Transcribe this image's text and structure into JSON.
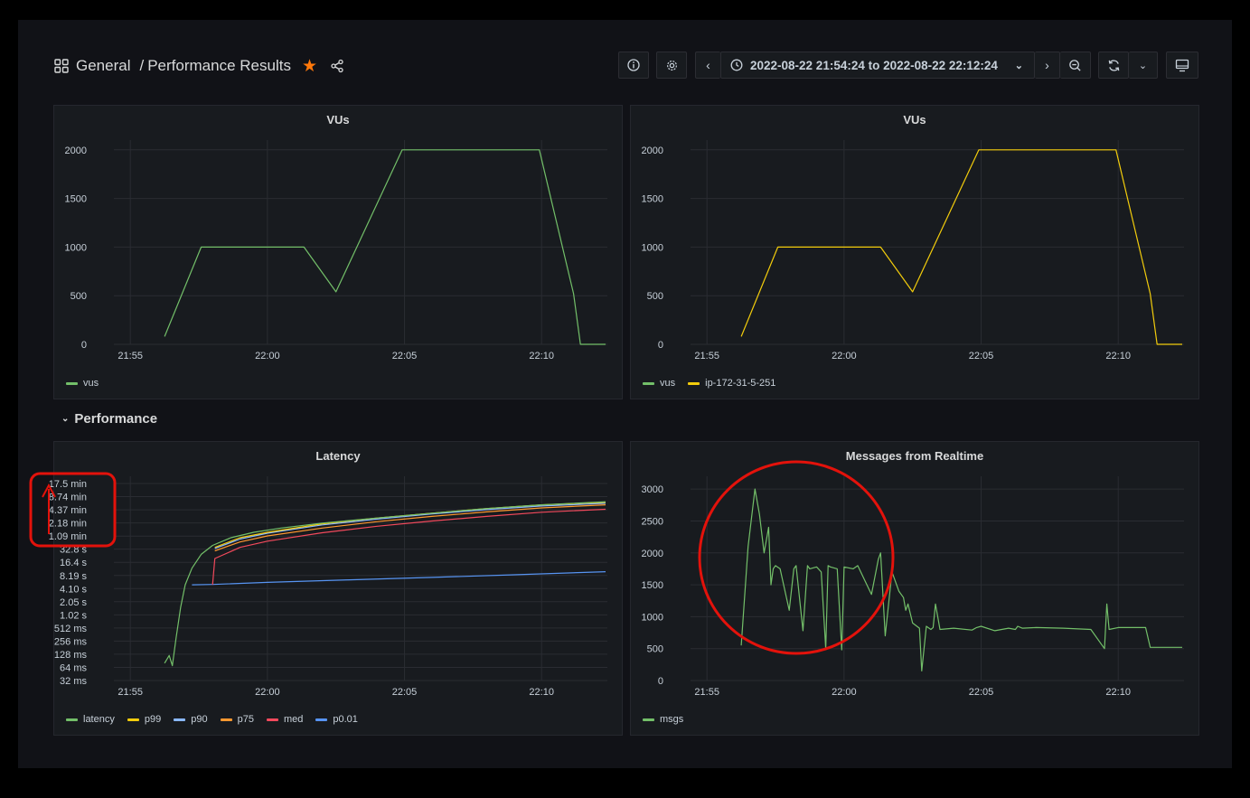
{
  "header": {
    "breadcrumb_root": "General",
    "breadcrumb_sep": "/",
    "breadcrumb_page": "Performance Results"
  },
  "toolbar": {
    "time_range": "2022-08-22 21:54:24 to 2022-08-22 22:12:24"
  },
  "section": {
    "title": "Performance"
  },
  "colors": {
    "green": "#73bf69",
    "yellow": "#f2cc0c",
    "light_blue": "#8ab8ff",
    "orange": "#ff9830",
    "red": "#f2495c",
    "blue": "#5794f2",
    "annotation_red": "#e3120b",
    "star": "#ff780a"
  },
  "panels": {
    "vus1": {
      "title": "VUs",
      "legend": [
        {
          "name": "vus",
          "color": "#73bf69"
        }
      ]
    },
    "vus2": {
      "title": "VUs",
      "legend": [
        {
          "name": "vus",
          "color": "#73bf69"
        },
        {
          "name": "ip-172-31-5-251",
          "color": "#f2cc0c"
        }
      ]
    },
    "latency": {
      "title": "Latency",
      "legend": [
        {
          "name": "latency",
          "color": "#73bf69"
        },
        {
          "name": "p99",
          "color": "#f2cc0c"
        },
        {
          "name": "p90",
          "color": "#8ab8ff"
        },
        {
          "name": "p75",
          "color": "#ff9830"
        },
        {
          "name": "med",
          "color": "#f2495c"
        },
        {
          "name": "p0.01",
          "color": "#5794f2"
        }
      ]
    },
    "messages": {
      "title": "Messages from Realtime",
      "legend": [
        {
          "name": "msgs",
          "color": "#73bf69"
        }
      ]
    }
  },
  "chart_data": [
    {
      "id": "vus1",
      "type": "line",
      "title": "VUs",
      "ylim": [
        0,
        2100
      ],
      "xlim": [
        "21:54:24",
        "22:12:24"
      ],
      "yticks": [
        0,
        500,
        1000,
        1500,
        2000
      ],
      "xticks": [
        "21:55",
        "22:00",
        "22:05",
        "22:10"
      ],
      "series": [
        {
          "name": "vus",
          "color": "#73bf69",
          "x": [
            "21:56:15",
            "21:57:35",
            "22:01:20",
            "22:02:30",
            "22:04:55",
            "22:09:55",
            "22:11:10",
            "22:11:25",
            "22:12:20"
          ],
          "y": [
            80,
            1000,
            1000,
            540,
            2000,
            2000,
            520,
            0,
            0
          ]
        }
      ]
    },
    {
      "id": "vus2",
      "type": "line",
      "title": "VUs",
      "ylim": [
        0,
        2100
      ],
      "xlim": [
        "21:54:24",
        "22:12:24"
      ],
      "yticks": [
        0,
        500,
        1000,
        1500,
        2000
      ],
      "xticks": [
        "21:55",
        "22:00",
        "22:05",
        "22:10"
      ],
      "series": [
        {
          "name": "ip-172-31-5-251",
          "color": "#f2cc0c",
          "x": [
            "21:56:15",
            "21:57:35",
            "22:01:20",
            "22:02:30",
            "22:04:55",
            "22:09:55",
            "22:11:10",
            "22:11:25",
            "22:12:20"
          ],
          "y": [
            80,
            1000,
            1000,
            540,
            2000,
            2000,
            520,
            0,
            0
          ]
        }
      ]
    },
    {
      "id": "latency",
      "type": "line",
      "title": "Latency",
      "scale": "log2",
      "xlim": [
        "21:54:24",
        "22:12:24"
      ],
      "yticks": [
        "32 ms",
        "64 ms",
        "128 ms",
        "256 ms",
        "512 ms",
        "1.02 s",
        "2.05 s",
        "4.10 s",
        "8.19 s",
        "16.4 s",
        "32.8 s",
        "1.09 min",
        "2.18 min",
        "4.37 min",
        "8.74 min",
        "17.5 min"
      ],
      "xticks": [
        "21:55",
        "22:00",
        "22:05",
        "22:10"
      ],
      "series": [
        {
          "name": "latency",
          "color": "#73bf69",
          "x": [
            "21:56:15",
            "21:56:25",
            "21:56:32",
            "21:56:40",
            "21:56:50",
            "21:57:00",
            "21:57:15",
            "21:57:35",
            "21:58:00",
            "21:58:40",
            "21:59:30",
            "22:00:30",
            "22:02:00",
            "22:04:00",
            "22:06:00",
            "22:08:00",
            "22:10:00",
            "22:12:20"
          ],
          "y_ms": [
            80,
            120,
            70,
            300,
            1500,
            5000,
            12000,
            25000,
            40000,
            60000,
            80000,
            100000,
            130000,
            170000,
            220000,
            280000,
            340000,
            400000
          ]
        },
        {
          "name": "p99",
          "color": "#f2cc0c",
          "x": [
            "21:58:05",
            "21:59:00",
            "22:00:00",
            "22:02:00",
            "22:04:00",
            "22:06:00",
            "22:08:00",
            "22:10:00",
            "22:12:20"
          ],
          "y_ms": [
            36000,
            60000,
            80000,
            125000,
            170000,
            220000,
            280000,
            340000,
            390000
          ]
        },
        {
          "name": "p90",
          "color": "#8ab8ff",
          "x": [
            "21:58:05",
            "21:59:00",
            "22:00:00",
            "22:02:00",
            "22:04:00",
            "22:06:00",
            "22:08:00",
            "22:10:00",
            "22:12:20"
          ],
          "y_ms": [
            34000,
            56000,
            76000,
            118000,
            160000,
            210000,
            265000,
            320000,
            370000
          ]
        },
        {
          "name": "p75",
          "color": "#ff9830",
          "x": [
            "21:58:05",
            "21:59:00",
            "22:00:00",
            "22:02:00",
            "22:04:00",
            "22:06:00",
            "22:08:00",
            "22:10:00",
            "22:12:20"
          ],
          "y_ms": [
            30000,
            48000,
            66000,
            100000,
            140000,
            185000,
            235000,
            290000,
            340000
          ]
        },
        {
          "name": "med",
          "color": "#f2495c",
          "x": [
            "21:58:00",
            "21:58:05",
            "21:59:00",
            "22:00:00",
            "22:02:00",
            "22:04:00",
            "22:06:00",
            "22:08:00",
            "22:10:00",
            "22:12:20"
          ],
          "y_ms": [
            5000,
            20000,
            36000,
            50000,
            78000,
            110000,
            145000,
            185000,
            230000,
            270000
          ]
        },
        {
          "name": "p0.01",
          "color": "#5794f2",
          "x": [
            "21:57:15",
            "21:58:00",
            "22:00:00",
            "22:03:00",
            "22:06:00",
            "22:09:00",
            "22:12:20"
          ],
          "y_ms": [
            5000,
            5100,
            5700,
            6500,
            7400,
            8500,
            10000
          ]
        }
      ]
    },
    {
      "id": "messages",
      "type": "line",
      "title": "Messages from Realtime",
      "ylim": [
        0,
        3200
      ],
      "xlim": [
        "21:54:24",
        "22:12:24"
      ],
      "yticks": [
        0,
        500,
        1000,
        1500,
        2000,
        2500,
        3000
      ],
      "xticks": [
        "21:55",
        "22:00",
        "22:05",
        "22:10"
      ],
      "series": [
        {
          "name": "msgs",
          "color": "#73bf69",
          "x": [
            "21:56:15",
            "21:56:30",
            "21:56:45",
            "21:56:55",
            "21:57:05",
            "21:57:15",
            "21:57:20",
            "21:57:25",
            "21:57:30",
            "21:57:40",
            "21:58:00",
            "21:58:10",
            "21:58:15",
            "21:58:30",
            "21:58:40",
            "21:58:45",
            "21:59:00",
            "21:59:10",
            "21:59:20",
            "21:59:25",
            "21:59:30",
            "21:59:45",
            "21:59:55",
            "22:00:00",
            "22:00:20",
            "22:00:30",
            "22:01:00",
            "22:01:15",
            "22:01:20",
            "22:01:30",
            "22:01:45",
            "22:02:00",
            "22:02:10",
            "22:02:15",
            "22:02:20",
            "22:02:30",
            "22:02:45",
            "22:02:50",
            "22:03:00",
            "22:03:10",
            "22:03:15",
            "22:03:20",
            "22:03:30",
            "22:04:00",
            "22:04:40",
            "22:04:50",
            "22:05:00",
            "22:05:30",
            "22:06:00",
            "22:06:15",
            "22:06:20",
            "22:06:30",
            "22:07:00",
            "22:08:00",
            "22:09:00",
            "22:09:30",
            "22:09:35",
            "22:09:40",
            "22:10:00",
            "22:11:00",
            "22:11:10",
            "22:11:15",
            "22:12:20"
          ],
          "y": [
            550,
            2100,
            3000,
            2600,
            2000,
            2400,
            1500,
            1750,
            1800,
            1750,
            1100,
            1750,
            1800,
            780,
            1800,
            1750,
            1780,
            1700,
            500,
            1800,
            1780,
            1750,
            480,
            1780,
            1750,
            1800,
            1350,
            1900,
            2000,
            700,
            1700,
            1400,
            1300,
            1100,
            1200,
            900,
            820,
            150,
            850,
            800,
            830,
            1200,
            800,
            820,
            790,
            830,
            850,
            780,
            820,
            800,
            850,
            820,
            830,
            820,
            800,
            500,
            1200,
            800,
            830,
            830,
            520,
            520,
            520
          ]
        }
      ]
    }
  ]
}
